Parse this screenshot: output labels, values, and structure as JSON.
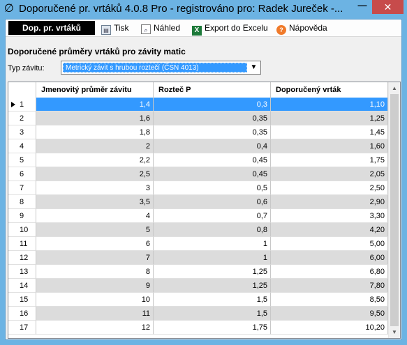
{
  "window": {
    "title": "Doporučené pr. vrtáků 4.0.8 Pro - registrováno pro: Radek Jureček -...",
    "minimize_label": "—",
    "close_label": "✕"
  },
  "toolbar": {
    "main_tab": "Dop. pr. vrtáků",
    "print_label": "Tisk",
    "preview_label": "Náhled",
    "export_label": "Export do Excelu",
    "help_label": "Nápověda"
  },
  "section": {
    "heading": "Doporučené průměry vrtáků pro závity matic",
    "type_label": "Typ závitu:",
    "type_value": "Metrický závit s hrubou roztečí (ČSN 4013)"
  },
  "table": {
    "columns": [
      "Jmenovitý průměr závitu",
      "Rozteč P",
      "Doporučený vrták"
    ],
    "rows": [
      {
        "n": "1",
        "d": "1,4",
        "p": "0,3",
        "v": "1,10"
      },
      {
        "n": "2",
        "d": "1,6",
        "p": "0,35",
        "v": "1,25"
      },
      {
        "n": "3",
        "d": "1,8",
        "p": "0,35",
        "v": "1,45"
      },
      {
        "n": "4",
        "d": "2",
        "p": "0,4",
        "v": "1,60"
      },
      {
        "n": "5",
        "d": "2,2",
        "p": "0,45",
        "v": "1,75"
      },
      {
        "n": "6",
        "d": "2,5",
        "p": "0,45",
        "v": "2,05"
      },
      {
        "n": "7",
        "d": "3",
        "p": "0,5",
        "v": "2,50"
      },
      {
        "n": "8",
        "d": "3,5",
        "p": "0,6",
        "v": "2,90"
      },
      {
        "n": "9",
        "d": "4",
        "p": "0,7",
        "v": "3,30"
      },
      {
        "n": "10",
        "d": "5",
        "p": "0,8",
        "v": "4,20"
      },
      {
        "n": "11",
        "d": "6",
        "p": "1",
        "v": "5,00"
      },
      {
        "n": "12",
        "d": "7",
        "p": "1",
        "v": "6,00"
      },
      {
        "n": "13",
        "d": "8",
        "p": "1,25",
        "v": "6,80"
      },
      {
        "n": "14",
        "d": "9",
        "p": "1,25",
        "v": "7,80"
      },
      {
        "n": "15",
        "d": "10",
        "p": "1,5",
        "v": "8,50"
      },
      {
        "n": "16",
        "d": "11",
        "p": "1,5",
        "v": "9,50"
      },
      {
        "n": "17",
        "d": "12",
        "p": "1,75",
        "v": "10,20"
      }
    ]
  },
  "colors": {
    "titlebar": "#6cb3e3",
    "selection": "#3399ff",
    "alt_row": "#dcdcdc",
    "close_button": "#c74b4b"
  }
}
